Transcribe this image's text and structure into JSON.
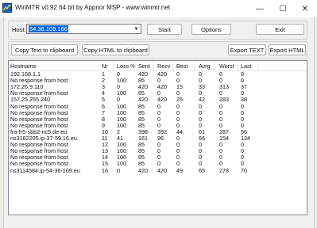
{
  "window": {
    "title": "WinMTR v0.92 64 bit by Appnor MSP - www.winmtr.net",
    "minimize_glyph": "—",
    "maximize_glyph": "☐",
    "close_glyph": "✕"
  },
  "host": {
    "label": "Host:",
    "value": "54.36.109.166"
  },
  "buttons": {
    "start": "Start",
    "options": "Options",
    "exit": "Exit",
    "copy_text": "Copy Text to clipboard",
    "copy_html": "Copy HTML to clipboard",
    "export_text": "Export TEXT",
    "export_html": "Export HTML"
  },
  "table": {
    "columns": [
      "Hostname",
      "Nr",
      "Loss %",
      "Sent",
      "Recv",
      "Best",
      "Avrg",
      "Worst",
      "Last"
    ],
    "rows": [
      [
        "192.168.1.1",
        "1",
        "0",
        "420",
        "420",
        "0",
        "0",
        "6",
        "0"
      ],
      [
        "No response from host",
        "2",
        "100",
        "85",
        "0",
        "0",
        "0",
        "0",
        "0"
      ],
      [
        "172.26.9.110",
        "3",
        "0",
        "420",
        "420",
        "15",
        "33",
        "313",
        "37"
      ],
      [
        "No response from host",
        "4",
        "100",
        "85",
        "0",
        "0",
        "0",
        "0",
        "0"
      ],
      [
        "157.25.255.240",
        "5",
        "0",
        "420",
        "420",
        "25",
        "42",
        "283",
        "38"
      ],
      [
        "No response from host",
        "6",
        "100",
        "85",
        "0",
        "0",
        "0",
        "0",
        "0"
      ],
      [
        "No response from host",
        "7",
        "100",
        "85",
        "0",
        "0",
        "0",
        "0",
        "0"
      ],
      [
        "No response from host",
        "8",
        "100",
        "85",
        "0",
        "0",
        "0",
        "0",
        "0"
      ],
      [
        "No response from host",
        "9",
        "100",
        "85",
        "0",
        "0",
        "0",
        "0",
        "0"
      ],
      [
        "fra-fr5-sbb2-nc5.de.eu",
        "10",
        "2",
        "398",
        "392",
        "44",
        "61",
        "287",
        "56"
      ],
      [
        "ns3182205.ip-37-59.16.eu",
        "11",
        "41",
        "161",
        "96",
        "0",
        "66",
        "154",
        "134"
      ],
      [
        "No response from host",
        "12",
        "100",
        "85",
        "0",
        "0",
        "0",
        "0",
        "0"
      ],
      [
        "No response from host",
        "13",
        "100",
        "85",
        "0",
        "0",
        "0",
        "0",
        "0"
      ],
      [
        "No response from host",
        "14",
        "100",
        "85",
        "0",
        "0",
        "0",
        "0",
        "0"
      ],
      [
        "No response from host",
        "15",
        "100",
        "85",
        "0",
        "0",
        "0",
        "0",
        "0"
      ],
      [
        "ns3114584.ip-54-36-109.eu",
        "16",
        "0",
        "420",
        "420",
        "49",
        "65",
        "278",
        "70"
      ]
    ]
  }
}
